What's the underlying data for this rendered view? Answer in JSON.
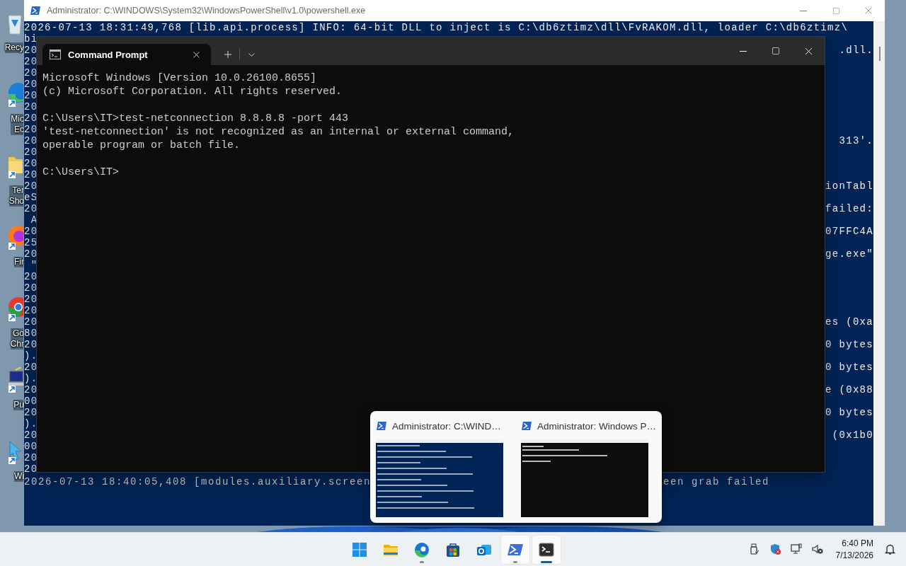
{
  "desktop": {
    "icons": [
      {
        "kind": "recycle-bin",
        "lines": [
          "Recy"
        ]
      },
      {
        "kind": "edge",
        "lines": [
          "Mic",
          "Ec"
        ]
      },
      {
        "kind": "folder",
        "lines": [
          "Ter",
          "Sho"
        ]
      },
      {
        "kind": "firefox",
        "lines": [
          "Fir"
        ]
      },
      {
        "kind": "chrome",
        "lines": [
          "Go",
          "Chr"
        ]
      },
      {
        "kind": "putty",
        "lines": [
          "Pu"
        ]
      },
      {
        "kind": "arrow",
        "lines": [
          "Wi"
        ]
      }
    ]
  },
  "powershell": {
    "title": "Administrator: C:\\WINDOWS\\System32\\WindowsPowerShell\\v1.0\\powershell.exe",
    "lines": [
      {
        "text": "2026-07-13 18:31:49,768 [lib.api.process] INFO: 64-bit DLL to inject is C:\\db6ztimz\\dll\\FvRAKOM.dll, loader C:\\db6ztimz\\"
      },
      {
        "text": "bi"
      },
      {
        "text": "20",
        "end": ".dll."
      },
      {
        "text": "20"
      },
      {
        "text": "20"
      },
      {
        "text": "20"
      },
      {
        "text": "20"
      },
      {
        "text": "20"
      },
      {
        "text": "20"
      },
      {
        "text": "20"
      },
      {
        "text": "20",
        "end": "313'."
      },
      {
        "text": "20"
      },
      {
        "text": "20"
      },
      {
        "text": "20"
      },
      {
        "text": "20",
        "end": "ionTabl"
      },
      {
        "text": "eS"
      },
      {
        "text": "20",
        "end": "failed:"
      },
      {
        "text": " A"
      },
      {
        "text": "20",
        "end": "07FFC4A"
      },
      {
        "text": "25"
      },
      {
        "text": "20",
        "end": "ge.exe\""
      },
      {
        "text": " \""
      },
      {
        "text": "20"
      },
      {
        "text": "20"
      },
      {
        "text": "20"
      },
      {
        "text": "20"
      },
      {
        "text": "20",
        "end": "es (0xa"
      },
      {
        "text": "80"
      },
      {
        "text": "20",
        "end": "0 bytes"
      },
      {
        "text": ")."
      },
      {
        "text": "20",
        "end": "0 bytes"
      },
      {
        "text": ")."
      },
      {
        "text": "20",
        "end": "e (0x88"
      },
      {
        "text": "00"
      },
      {
        "text": "20",
        "end": "0 bytes"
      },
      {
        "text": ")."
      },
      {
        "text": "20",
        "end": " (0x1b0"
      },
      {
        "text": "00"
      },
      {
        "text": "20"
      },
      {
        "text": "20"
      },
      {
        "text": "2026-07-13 18:40:05,408 [modules.auxiliary.screen",
        "tail": "een grab failed"
      }
    ]
  },
  "terminal": {
    "tabs": [
      {
        "title": "Command Prompt",
        "selected": true
      }
    ],
    "blocks": [
      [
        "Microsoft Windows [Version 10.0.26100.8655]",
        "(c) Microsoft Corporation. All rights reserved."
      ],
      [
        "C:\\Users\\IT>test-netconnection 8.8.8.8 -port 443",
        "'test-netconnection' is not recognized as an internal or external command,",
        "operable program or batch file."
      ],
      [
        "C:\\Users\\IT>"
      ]
    ]
  },
  "task_preview": {
    "items": [
      {
        "title": "Administrator: C:\\WIND…",
        "kind": "powershell"
      },
      {
        "title": "Administrator: Windows P…",
        "kind": "console"
      }
    ]
  },
  "taskbar": {
    "apps": [
      {
        "kind": "start",
        "running": false,
        "focused": false,
        "highlighted": false
      },
      {
        "kind": "explorer",
        "running": false,
        "focused": false,
        "highlighted": false
      },
      {
        "kind": "edge",
        "running": true,
        "focused": false,
        "highlighted": false
      },
      {
        "kind": "store",
        "running": false,
        "focused": false,
        "highlighted": false
      },
      {
        "kind": "outlook",
        "running": false,
        "focused": false,
        "highlighted": false
      },
      {
        "kind": "powershell",
        "running": true,
        "focused": false,
        "highlighted": true
      },
      {
        "kind": "terminal",
        "running": true,
        "focused": true,
        "highlighted": true
      }
    ],
    "tray": [
      {
        "kind": "usb"
      },
      {
        "kind": "defender"
      },
      {
        "kind": "network"
      },
      {
        "kind": "volume"
      }
    ],
    "clock": {
      "time": "6:40 PM",
      "date": "7/13/2026"
    }
  }
}
